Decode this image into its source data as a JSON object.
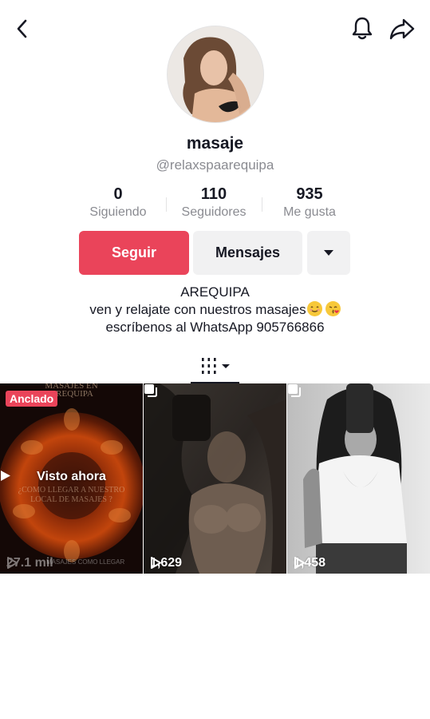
{
  "profile": {
    "name": "masaje",
    "handle": "@relaxspaarequipa",
    "stats": [
      {
        "value": "0",
        "label": "Siguiendo"
      },
      {
        "value": "110",
        "label": "Seguidores"
      },
      {
        "value": "935",
        "label": "Me gusta"
      }
    ],
    "buttons": {
      "follow": "Seguir",
      "message": "Mensajes"
    },
    "bio": [
      "AREQUIPA",
      "ven y relajate con nuestros masajes",
      "escríbenos al WhatsApp 905766866"
    ]
  },
  "icons": {
    "back": "chevron-left-icon",
    "bell": "bell-icon",
    "share": "share-arrow-icon",
    "grid_tab": "grid-icon",
    "dropdown": "caret-down-icon"
  },
  "videos": [
    {
      "views": "27.1 mil",
      "pinned_label": "Anclado",
      "overlay": "Visto ahora",
      "text_lines": [
        "MASAJES EN",
        "AREQUIPA",
        "¿COMO LLEGAR A NUESTRO",
        "LOCAL DE MASAJES ?"
      ],
      "corner_text": "MASAJES COMO LLEGAR"
    },
    {
      "views": "1,629",
      "multi": true
    },
    {
      "views": "1,458",
      "multi": true
    }
  ],
  "colors": {
    "accent": "#ea445a",
    "text": "#161823",
    "secondary": "#8a8b91",
    "button_bg": "#f1f1f2"
  }
}
